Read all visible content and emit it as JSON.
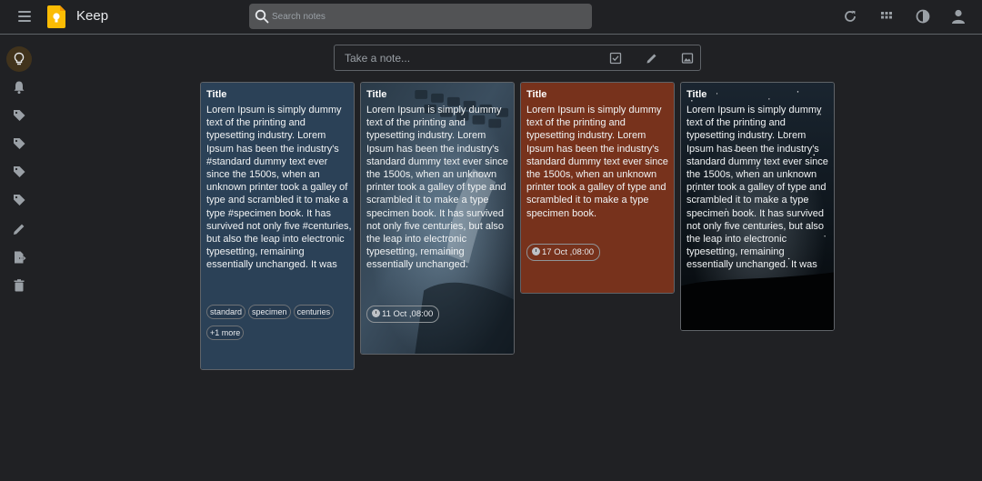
{
  "header": {
    "app_title": "Keep",
    "search_placeholder": "Search notes",
    "icons": [
      "menu-icon",
      "keep-logo",
      "search-icon",
      "refresh-icon",
      "apps-grid-icon",
      "theme-toggle-icon",
      "account-icon"
    ]
  },
  "sidebar": {
    "items": [
      {
        "name": "notes",
        "icon": "lightbulb-icon",
        "active": true
      },
      {
        "name": "reminders",
        "icon": "bell-icon"
      },
      {
        "name": "label-1",
        "icon": "label-icon"
      },
      {
        "name": "label-2",
        "icon": "label-icon"
      },
      {
        "name": "label-3",
        "icon": "label-icon"
      },
      {
        "name": "label-4",
        "icon": "label-icon"
      },
      {
        "name": "edit-labels",
        "icon": "pencil-icon"
      },
      {
        "name": "archive",
        "icon": "archive-icon"
      },
      {
        "name": "trash",
        "icon": "trash-icon"
      }
    ]
  },
  "take_note": {
    "placeholder": "Take a note...",
    "icons": [
      "checkbox-icon",
      "brush-icon",
      "image-icon"
    ]
  },
  "notes": [
    {
      "title": "Title",
      "body": "Lorem Ipsum is simply dummy text of the printing and typesetting industry. Lorem Ipsum has been the industry's #standard dummy text ever since the 1500s, when an unknown printer took a galley of type and scrambled it to make a type #specimen book. It has survived not only five #centuries, but also the leap into electronic typesetting, remaining essentially unchanged. It was",
      "labels": [
        "standard",
        "specimen",
        "centuries"
      ],
      "more_labels": "+1 more",
      "background": "#2b4157"
    },
    {
      "title": "Title",
      "body": "Lorem Ipsum is simply dummy text of the printing and typesetting industry. Lorem Ipsum has been the industry's standard dummy text ever since the 1500s, when an unknown printer took a galley of type and scrambled it to make a type specimen book. It has survived not only five centuries, but also the leap into electronic typesetting, remaining essentially unchanged.",
      "reminder": "11 Oct ,08:00",
      "background": "keyboard-image"
    },
    {
      "title": "Title",
      "body": "Lorem Ipsum is simply dummy text of the printing and typesetting industry. Lorem Ipsum has been the industry's standard dummy text ever since the 1500s, when an unknown printer took a galley of type and scrambled it to make a type specimen book.",
      "reminder": "17 Oct ,08:00",
      "background": "#77321c"
    },
    {
      "title": "Title",
      "body": "Lorem Ipsum is simply dummy text of the printing and typesetting industry. Lorem Ipsum has been the industry's standard dummy text ever since the 1500s, when an unknown printer took a galley of type and scrambled it to make a type specimen book. It has survived not only five centuries, but also the leap into electronic typesetting, remaining essentially unchanged. It was",
      "background": "night-sky-image"
    }
  ]
}
